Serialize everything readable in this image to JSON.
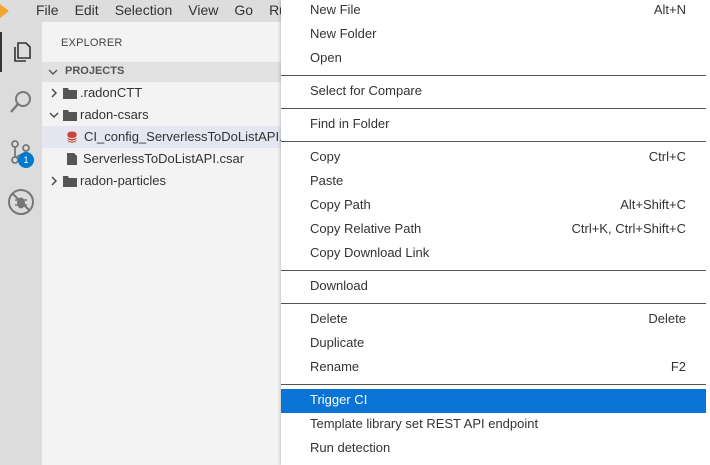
{
  "menubar": {
    "items": [
      "File",
      "Edit",
      "Selection",
      "View",
      "Go",
      "Run"
    ]
  },
  "activity": {
    "scm_badge": "1"
  },
  "explorer": {
    "title": "EXPLORER",
    "section": "PROJECTS",
    "tree": [
      {
        "name": ".radonCTT",
        "kind": "folder",
        "expanded": false
      },
      {
        "name": "radon-csars",
        "kind": "folder",
        "expanded": true
      },
      {
        "name": "CI_config_ServerlessToDoListAPI.",
        "kind": "file-db",
        "selected": true
      },
      {
        "name": "ServerlessToDoListAPI.csar",
        "kind": "file"
      },
      {
        "name": "radon-particles",
        "kind": "folder",
        "expanded": false
      }
    ]
  },
  "context_menu": {
    "items": [
      {
        "label": "New File",
        "shortcut": "Alt+N"
      },
      {
        "label": "New Folder",
        "shortcut": ""
      },
      {
        "label": "Open",
        "shortcut": ""
      },
      {
        "label": "Select for Compare",
        "shortcut": ""
      },
      {
        "label": "Find in Folder",
        "shortcut": ""
      },
      {
        "label": "Copy",
        "shortcut": "Ctrl+C"
      },
      {
        "label": "Paste",
        "shortcut": ""
      },
      {
        "label": "Copy Path",
        "shortcut": "Alt+Shift+C"
      },
      {
        "label": "Copy Relative Path",
        "shortcut": "Ctrl+K, Ctrl+Shift+C"
      },
      {
        "label": "Copy Download Link",
        "shortcut": ""
      },
      {
        "label": "Download",
        "shortcut": ""
      },
      {
        "label": "Delete",
        "shortcut": "Delete"
      },
      {
        "label": "Duplicate",
        "shortcut": ""
      },
      {
        "label": "Rename",
        "shortcut": "F2"
      },
      {
        "label": "Trigger CI",
        "shortcut": "",
        "highlighted": true
      },
      {
        "label": "Template library set REST API endpoint",
        "shortcut": ""
      },
      {
        "label": "Run detection",
        "shortcut": ""
      }
    ]
  },
  "colors": {
    "accent": "#0a74d6",
    "badge": "#007acc",
    "logo": "#f0a732",
    "db_icon": "#c4453c"
  }
}
